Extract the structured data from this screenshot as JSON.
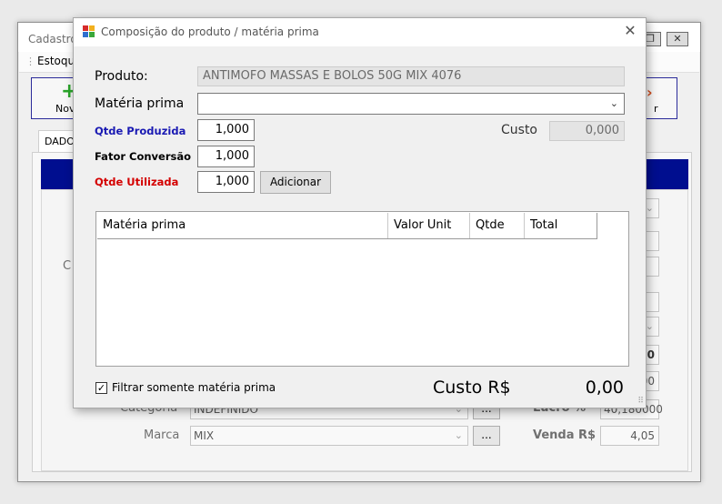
{
  "background_window": {
    "title": "Cadastro",
    "menu": {
      "item": "Estoque"
    },
    "toolbar": {
      "new_label": "Novo",
      "close_label": "r"
    },
    "tab": "DADO",
    "band_text": "",
    "partial_label_c": "C",
    "fields": {
      "categoria_label": "Categoria",
      "categoria_value": "INDEFINIDO",
      "marca_label": "Marca",
      "marca_value": "MIX",
      "lucro_label": "Lucro %",
      "lucro_value": "40,180000",
      "venda_label": "Venda R$",
      "venda_value": "4,05",
      "partial_value_top": "0",
      "partial_value_mid": "00",
      "ellipsis": "..."
    }
  },
  "dialog": {
    "title": "Composição do produto / matéria prima",
    "produto": {
      "label": "Produto:",
      "value": "ANTIMOFO MASSAS E BOLOS 50G MIX 4076"
    },
    "materia_prima": {
      "label": "Matéria prima",
      "value": ""
    },
    "qtde_produzida": {
      "label": "Qtde Produzida",
      "value": "1,000"
    },
    "custo": {
      "label": "Custo",
      "value": "0,000"
    },
    "fator_conversao": {
      "label": "Fator Conversão",
      "value": "1,000"
    },
    "qtde_utilizada": {
      "label": "Qtde Utilizada",
      "value": "1,000"
    },
    "add_button": "Adicionar",
    "grid": {
      "columns": [
        "Matéria prima",
        "Valor Unit",
        "Qtde",
        "Total"
      ],
      "rows": []
    },
    "filter_checkbox": {
      "label": "Filtrar somente matéria prima",
      "checked": true
    },
    "custo_total": {
      "label": "Custo R$",
      "value": "0,00"
    }
  }
}
